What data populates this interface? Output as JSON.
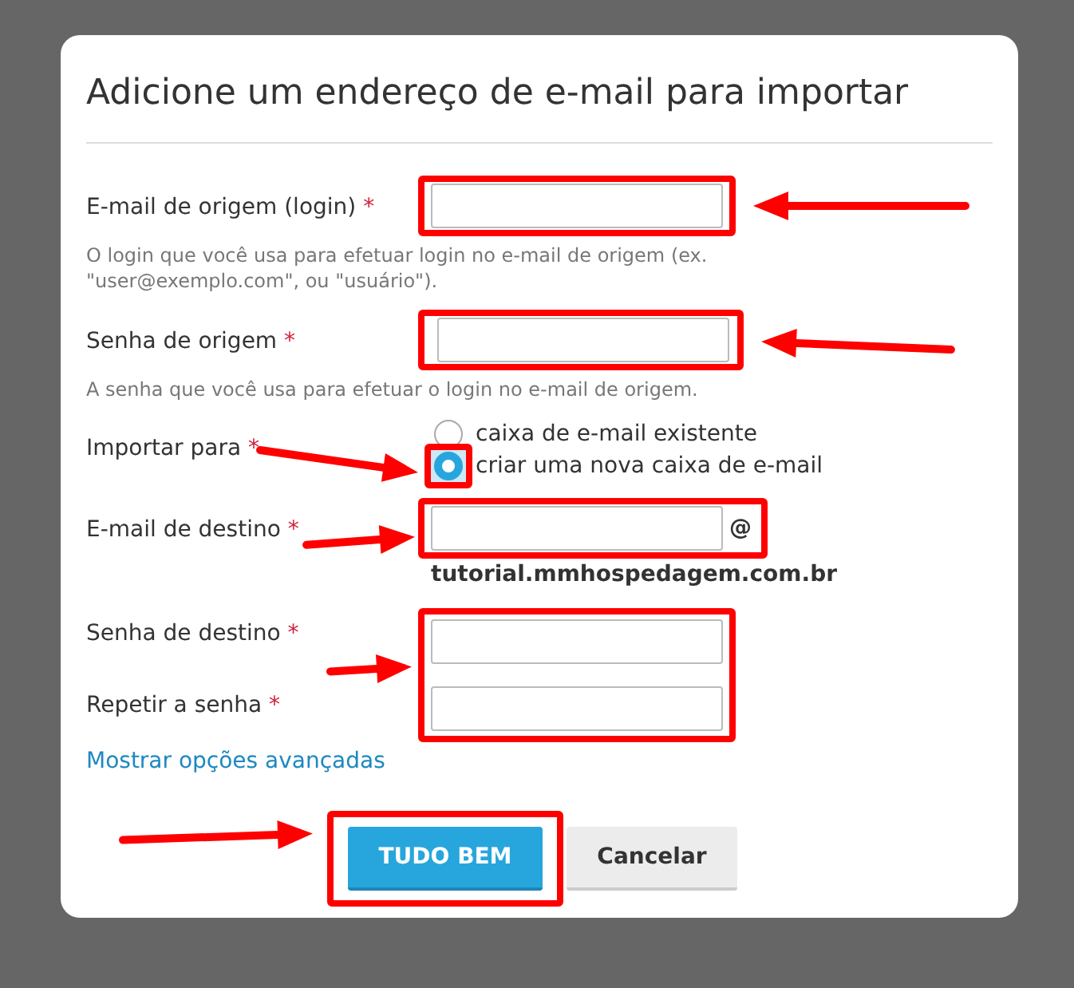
{
  "dialog": {
    "title": "Adicione um endereço de e-mail para importar"
  },
  "fields": [
    {
      "kind": "text",
      "label": "E-mail de origem (login)",
      "required": "*",
      "hint": "O login que você usa para efetuar login no e-mail de origem (ex. \"user@exemplo.com\", ou \"usuário\")."
    },
    {
      "kind": "password",
      "label": "Senha de origem",
      "required": "*",
      "hint": "A senha que você usa para efetuar o login no e-mail de origem."
    },
    {
      "kind": "radio",
      "label": "Importar para",
      "required": "*",
      "options": [
        {
          "label": "caixa de e-mail existente",
          "selected": false
        },
        {
          "label": "criar uma nova caixa de e-mail",
          "selected": true
        }
      ]
    },
    {
      "kind": "email",
      "label": "E-mail de destino",
      "required": "*",
      "suffix": "@",
      "domain": "tutorial.mmhospedagem.com.br"
    },
    {
      "kind": "passwords",
      "labels": [
        {
          "label": "Senha de destino",
          "required": "*"
        },
        {
          "label": "Repetir a senha",
          "required": "*"
        }
      ]
    }
  ],
  "link": "Mostrar opções avançadas",
  "buttons": [
    {
      "label": "TUDO BEM",
      "kind": "primary"
    },
    {
      "label": "Cancelar",
      "kind": "secondary"
    }
  ]
}
